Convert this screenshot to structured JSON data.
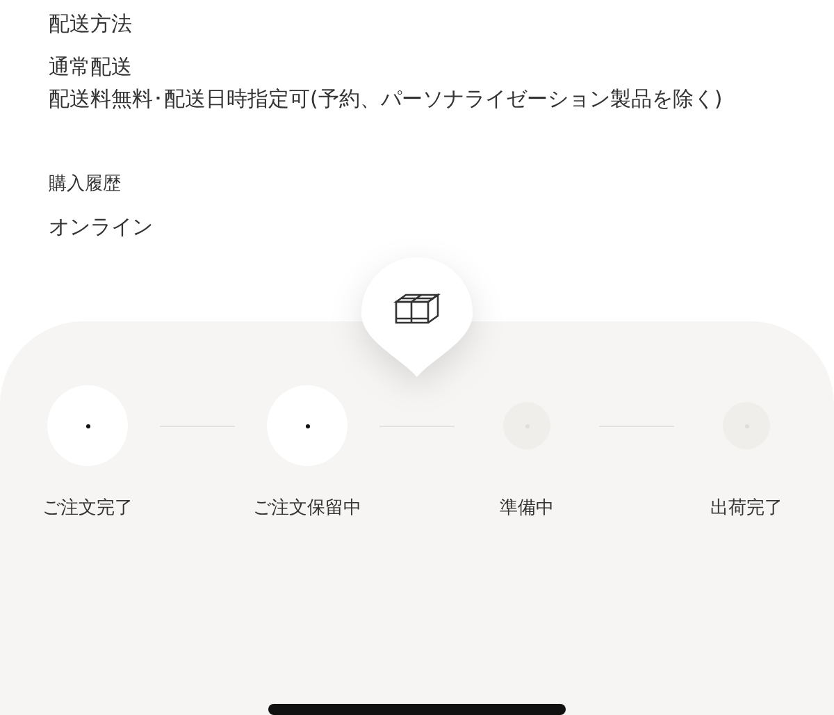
{
  "shipping": {
    "heading": "配送方法",
    "method": "通常配送",
    "note": "配送料無料･配送日時指定可(予約、パーソナライゼーション製品を除く)"
  },
  "purchase": {
    "heading": "購入履歴",
    "channel": "オンライン"
  },
  "steps": [
    {
      "label": "ご注文完了",
      "done": true
    },
    {
      "label": "ご注文保留中",
      "done": true
    },
    {
      "label": "準備中",
      "done": false
    },
    {
      "label": "出荷完了",
      "done": false
    }
  ]
}
